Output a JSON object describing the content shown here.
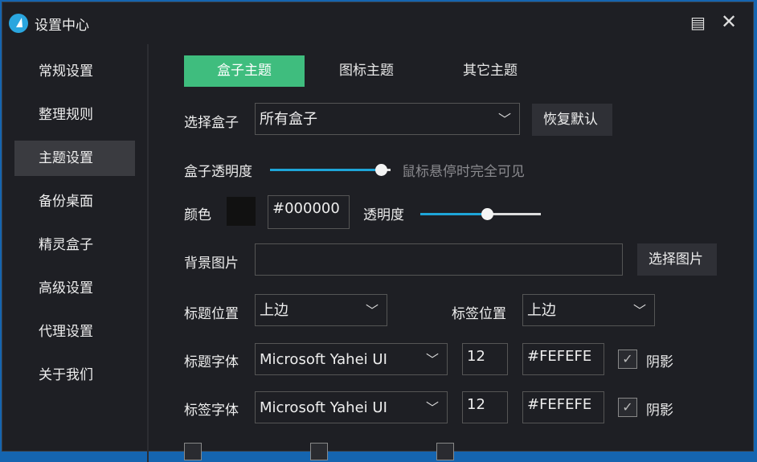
{
  "window": {
    "title": "设置中心",
    "icons": [
      "app-logo",
      "message-icon",
      "close-icon"
    ]
  },
  "sidebar": {
    "items": [
      {
        "label": "常规设置"
      },
      {
        "label": "整理规则"
      },
      {
        "label": "主题设置",
        "selected": true
      },
      {
        "label": "备份桌面"
      },
      {
        "label": "精灵盒子"
      },
      {
        "label": "高级设置"
      },
      {
        "label": "代理设置"
      },
      {
        "label": "关于我们"
      }
    ]
  },
  "tabs": [
    {
      "label": "盒子主题",
      "selected": true
    },
    {
      "label": "图标主题"
    },
    {
      "label": "其它主题"
    }
  ],
  "form": {
    "select_box_label": "选择盒子",
    "select_box_value": "所有盒子",
    "restore_default": "恢复默认",
    "box_opacity_label": "盒子透明度",
    "box_opacity_value": 1.0,
    "hover_visible_label": "鼠标悬停时完全可见",
    "color_label": "颜色",
    "color_value": "#000000",
    "color_swatch": "#111111",
    "opacity_label": "透明度",
    "opacity_value": 0.55,
    "bg_image_label": "背景图片",
    "bg_image_value": "",
    "choose_image": "选择图片",
    "title_pos_label": "标题位置",
    "title_pos_value": "上边",
    "tag_pos_label": "标签位置",
    "tag_pos_value": "上边",
    "title_font_label": "标题字体",
    "title_font_value": "Microsoft Yahei UI",
    "title_font_size": "12",
    "title_font_color": "#FEFEFE",
    "title_shadow_label": "阴影",
    "title_shadow_checked": true,
    "tag_font_label": "标签字体",
    "tag_font_value": "Microsoft Yahei UI",
    "tag_font_size": "12",
    "tag_font_color": "#FEFEFE",
    "tag_shadow_label": "阴影",
    "tag_shadow_checked": true
  },
  "colors": {
    "accent": "#3fbd7e",
    "slider": "#1ea5d8",
    "background": "#1e1f24"
  }
}
